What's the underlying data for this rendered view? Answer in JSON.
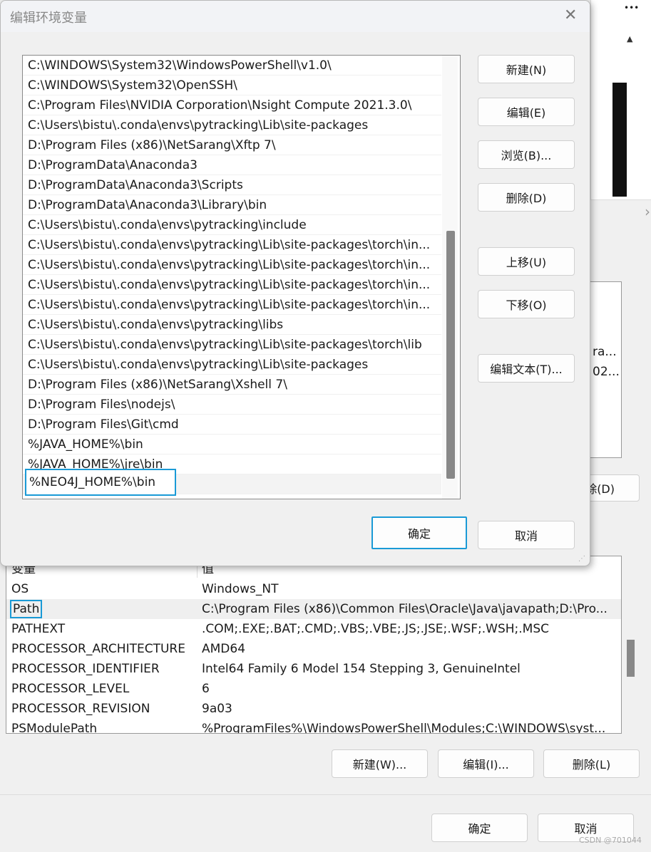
{
  "dialog": {
    "title": "编辑环境变量",
    "paths": [
      "C:\\WINDOWS\\System32\\WindowsPowerShell\\v1.0\\",
      "C:\\WINDOWS\\System32\\OpenSSH\\",
      "C:\\Program Files\\NVIDIA Corporation\\Nsight Compute 2021.3.0\\",
      "C:\\Users\\bistu\\.conda\\envs\\pytracking\\Lib\\site-packages",
      "D:\\Program Files (x86)\\NetSarang\\Xftp 7\\",
      "D:\\ProgramData\\Anaconda3",
      "D:\\ProgramData\\Anaconda3\\Scripts",
      "D:\\ProgramData\\Anaconda3\\Library\\bin",
      "C:\\Users\\bistu\\.conda\\envs\\pytracking\\include",
      "C:\\Users\\bistu\\.conda\\envs\\pytracking\\Lib\\site-packages\\torch\\in...",
      "C:\\Users\\bistu\\.conda\\envs\\pytracking\\Lib\\site-packages\\torch\\in...",
      "C:\\Users\\bistu\\.conda\\envs\\pytracking\\Lib\\site-packages\\torch\\in...",
      "C:\\Users\\bistu\\.conda\\envs\\pytracking\\Lib\\site-packages\\torch\\in...",
      "C:\\Users\\bistu\\.conda\\envs\\pytracking\\libs",
      "C:\\Users\\bistu\\.conda\\envs\\pytracking\\Lib\\site-packages\\torch\\lib",
      "C:\\Users\\bistu\\.conda\\envs\\pytracking\\Lib\\site-packages",
      "D:\\Program Files (x86)\\NetSarang\\Xshell 7\\",
      "D:\\Program Files\\nodejs\\",
      "D:\\Program Files\\Git\\cmd",
      "%JAVA_HOME%\\bin",
      "%JAVA_HOME%\\jre\\bin"
    ],
    "editing_value": "%NEO4J_HOME%\\bin",
    "buttons": {
      "new": "新建(N)",
      "edit": "编辑(E)",
      "browse": "浏览(B)...",
      "delete": "删除(D)",
      "up": "上移(U)",
      "down": "下移(O)",
      "edit_text": "编辑文本(T)...",
      "ok": "确定",
      "cancel": "取消"
    }
  },
  "background": {
    "more": "•••",
    "peek1": "ra...",
    "peek2": "02...",
    "peek_button": "除(D)",
    "table": {
      "headers": [
        "变量",
        "值"
      ],
      "rows": [
        [
          "OS",
          "Windows_NT"
        ],
        [
          "Path",
          "C:\\Program Files (x86)\\Common Files\\Oracle\\Java\\javapath;D:\\Pro..."
        ],
        [
          "PATHEXT",
          ".COM;.EXE;.BAT;.CMD;.VBS;.VBE;.JS;.JSE;.WSF;.WSH;.MSC"
        ],
        [
          "PROCESSOR_ARCHITECTURE",
          "AMD64"
        ],
        [
          "PROCESSOR_IDENTIFIER",
          "Intel64 Family 6 Model 154 Stepping 3, GenuineIntel"
        ],
        [
          "PROCESSOR_LEVEL",
          "6"
        ],
        [
          "PROCESSOR_REVISION",
          "9a03"
        ],
        [
          "PSModulePath",
          "%ProgramFiles%\\WindowsPowerShell\\Modules;C:\\WINDOWS\\syst..."
        ]
      ]
    },
    "buttons": {
      "new": "新建(W)...",
      "edit": "编辑(I)...",
      "delete": "删除(L)",
      "ok": "确定",
      "cancel": "取消"
    },
    "watermark": "CSDN @701044"
  },
  "colors": {
    "focus": "#1a9ad6"
  }
}
